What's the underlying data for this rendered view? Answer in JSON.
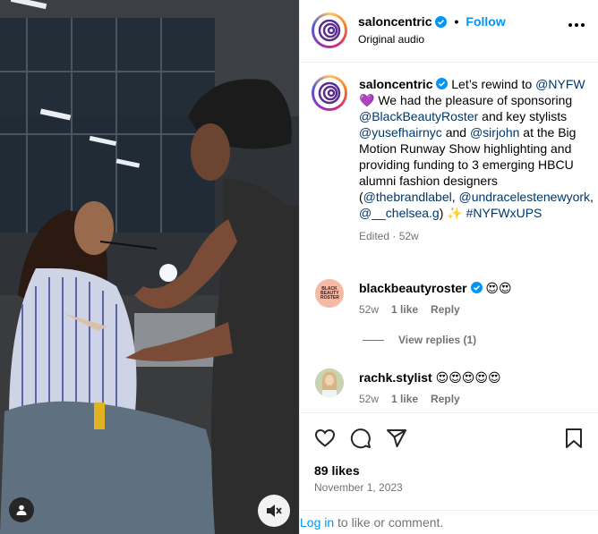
{
  "post": {
    "username": "saloncentric",
    "follow_label": "Follow",
    "audio_label": "Original audio",
    "caption_user": "saloncentric",
    "caption_parts": [
      {
        "t": " Let’s rewind to ",
        "k": "text"
      },
      {
        "t": "@NYFW",
        "k": "link"
      },
      {
        "t": " 💜 We had the pleasure of sponsoring ",
        "k": "text"
      },
      {
        "t": "@BlackBeautyRoster",
        "k": "link"
      },
      {
        "t": " and key stylists ",
        "k": "text"
      },
      {
        "t": "@yusefhairnyc",
        "k": "link"
      },
      {
        "t": " and ",
        "k": "text"
      },
      {
        "t": "@sirjohn",
        "k": "link"
      },
      {
        "t": " at the Big Motion Runway Show highlighting and providing funding to 3 emerging HBCU alumni fashion designers (",
        "k": "text"
      },
      {
        "t": "@thebrandlabel",
        "k": "link"
      },
      {
        "t": ", ",
        "k": "text"
      },
      {
        "t": "@undracelestenewyork",
        "k": "link"
      },
      {
        "t": ", ",
        "k": "text"
      },
      {
        "t": "@__chelsea.g",
        "k": "link"
      },
      {
        "t": ") ✨ ",
        "k": "text"
      },
      {
        "t": "#NYFWxUPS",
        "k": "link"
      }
    ],
    "caption_meta": "Edited · 52w",
    "likes": "89 likes",
    "date": "November 1, 2023"
  },
  "comments": [
    {
      "user": "blackbeautyroster",
      "verified": true,
      "text": "😍😍",
      "age": "52w",
      "likes": "1 like",
      "reply": "Reply",
      "avatar_text": "BLACK BEAUTY ROSTER"
    },
    {
      "user": "rachk.stylist",
      "verified": false,
      "text": "😍😍😍😍😍",
      "age": "52w",
      "likes": "1 like",
      "reply": "Reply"
    }
  ],
  "view_replies": "View replies (1)",
  "login": {
    "link": "Log in",
    "rest": " to like or comment."
  },
  "colors": {
    "accent": "#0095f6",
    "link": "#00376b",
    "muted": "#737373"
  }
}
